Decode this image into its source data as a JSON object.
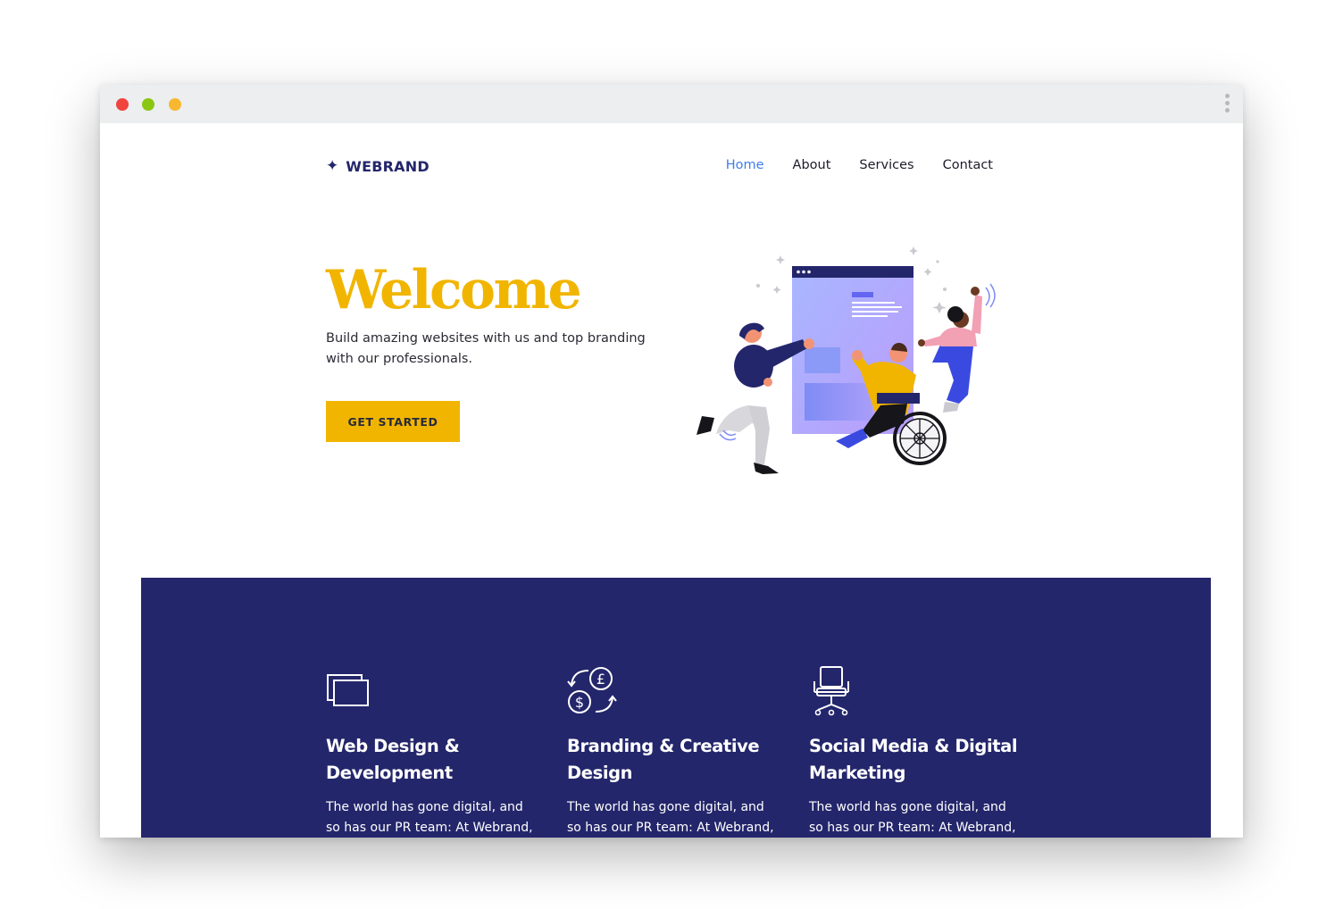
{
  "brand": {
    "icon": "sparkle-icon",
    "glyph": "✦",
    "name": "WEBRAND"
  },
  "nav": {
    "items": [
      {
        "label": "Home",
        "active": true
      },
      {
        "label": "About",
        "active": false
      },
      {
        "label": "Services",
        "active": false
      },
      {
        "label": "Contact",
        "active": false
      }
    ]
  },
  "hero": {
    "title": "Welcome",
    "subtitle": "Build amazing websites with us and top branding with our professionals.",
    "cta_label": "GET STARTED",
    "illustration": "team-collaboration-illustration"
  },
  "services": {
    "items": [
      {
        "icon": "windows-icon",
        "title": "Web Design & Development",
        "text": "The world has gone digital, and so has our PR team: At Webrand,"
      },
      {
        "icon": "currency-exchange-icon",
        "title": "Branding & Creative Design",
        "text": "The world has gone digital, and so has our PR team: At Webrand,"
      },
      {
        "icon": "office-chair-icon",
        "title": "Social Media & Digital Marketing",
        "text": "The world has gone digital, and so has our PR team: At Webrand,"
      }
    ]
  },
  "colors": {
    "brand_navy": "#24266b",
    "accent_yellow": "#f1b500",
    "link_blue": "#3e7de8",
    "titlebar": "#eceeef"
  }
}
